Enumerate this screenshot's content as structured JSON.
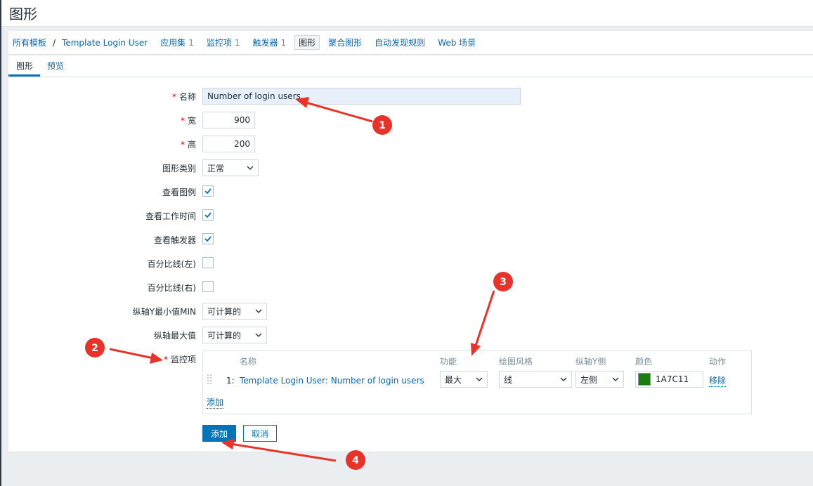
{
  "page": {
    "title": "图形"
  },
  "breadcrumb": {
    "all_templates": "所有模板",
    "separator": "/",
    "template_name": "Template Login User",
    "applications": {
      "label": "应用集",
      "count": "1"
    },
    "items": {
      "label": "监控项",
      "count": "1"
    },
    "triggers": {
      "label": "触发器",
      "count": "1"
    },
    "graphs": "图形",
    "screens": "聚合图形",
    "discovery": "自动发现规则",
    "web": "Web 场景"
  },
  "tabs": {
    "graph": "图形",
    "preview": "预览"
  },
  "form": {
    "name": {
      "label": "名称",
      "value": "Number of login users"
    },
    "width": {
      "label": "宽",
      "value": "900"
    },
    "height": {
      "label": "高",
      "value": "200"
    },
    "graph_type": {
      "label": "图形类别",
      "value": "正常"
    },
    "show_legend": {
      "label": "查看图例",
      "checked": true
    },
    "show_working_time": {
      "label": "查看工作时间",
      "checked": true
    },
    "show_triggers": {
      "label": "查看触发器",
      "checked": true
    },
    "percentile_left": {
      "label": "百分比线(左)",
      "checked": false
    },
    "percentile_right": {
      "label": "百分比线(右)",
      "checked": false
    },
    "y_min": {
      "label": "纵轴Y最小值MIN",
      "value": "可计算的"
    },
    "y_max": {
      "label": "纵轴最大值",
      "value": "可计算的"
    },
    "items_label": "监控项",
    "items_table": {
      "headers": {
        "name": "名称",
        "function": "功能",
        "draw_style": "绘图风格",
        "y_side": "纵轴Y侧",
        "color": "颜色",
        "action": "动作"
      },
      "rows": [
        {
          "num": "1:",
          "name": "Template Login User: Number of login users",
          "function": "最大",
          "draw_style": "线",
          "y_side": "左侧",
          "color": "1A7C11",
          "action": "移除"
        }
      ],
      "add_link": "添加"
    },
    "add_button": "添加",
    "cancel_button": "取消"
  },
  "annotations": [
    "1",
    "2",
    "3",
    "4"
  ],
  "colors": {
    "accent": "#0275b8",
    "link": "#0a66b2",
    "marker": "#e8332a",
    "item_color": "#1A7C11"
  }
}
